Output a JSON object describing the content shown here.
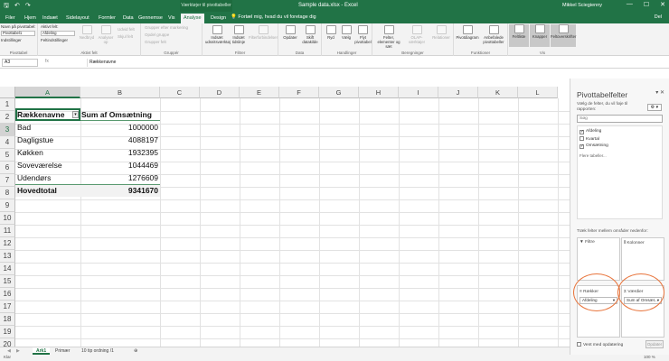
{
  "app": {
    "title": "Sample data.xlsx - Excel",
    "context_tab": "Værktøjer til pivottabeller",
    "user": "Mikkel Sciegienny"
  },
  "tabs": [
    "Filer",
    "Hjem",
    "Indsæt",
    "Sidelayout",
    "Formler",
    "Data",
    "Gennemse",
    "Vis",
    "Analyse",
    "Design"
  ],
  "active_tab": "Analyse",
  "tellme": "Fortæl mig, hvad du vil foretage dig",
  "share": "Del",
  "ribbon": {
    "pivot_name_label": "Navn på pivottabel:",
    "pivot_name_value": "Pivottabel1",
    "options_label": "Indstillinger",
    "active_field_label": "Aktivt felt:",
    "active_field_value": "Afdeling",
    "field_settings": "Feltindstillinger",
    "drilldown": "Nedbryd",
    "drillup": "Analyser op",
    "expand_field": "Udvid felt",
    "collapse_field": "Skjul felt",
    "group_selection": "Grupper efter markering",
    "ungroup": "Opdel gruppe",
    "group_field": "Grupper felt",
    "insert_slicer": "Indsæt udsnitsværktøj",
    "insert_timeline": "Indsæt tidslinje",
    "filter_connections": "Filterforbindelser",
    "refresh": "Opdater",
    "change_source": "Skift datakilde",
    "clear": "Ryd",
    "select": "Vælg",
    "move_pivot": "Flyt pivottabel",
    "fields_items_sets": "Felter, elementer og sæt",
    "olap_tools": "OLAP-værktøjer",
    "relations": "Relationer",
    "pivot_chart": "Pivotdiagram",
    "recommended": "Anbefalede pivottabeller",
    "field_list": "Feltliste",
    "buttons": "Knapper",
    "field_headers": "Feltoverskrifter",
    "groups": {
      "pivot": "Pivottabel",
      "active_field": "Aktivt felt",
      "group": "Gruppér",
      "filter": "Filtrer",
      "data": "Data",
      "actions": "Handlinger",
      "calculations": "Beregninger",
      "tools": "Funktioner",
      "show": "Vis"
    }
  },
  "formula_bar": {
    "name_box": "A3",
    "fx": "fx",
    "formula": "Rækkenavne"
  },
  "columns": [
    "A",
    "B",
    "C",
    "D",
    "E",
    "F",
    "G",
    "H",
    "I",
    "J",
    "K",
    "L"
  ],
  "rows": [
    "1",
    "2",
    "3",
    "4",
    "5",
    "6",
    "7",
    "8",
    "9",
    "10",
    "11",
    "12",
    "13",
    "14",
    "15",
    "16",
    "17",
    "18",
    "19",
    "20",
    "21"
  ],
  "pivot": {
    "header_label": "Rækkenavne",
    "header_value": "Sum af Omsætning",
    "items": [
      {
        "label": "Bad",
        "value": "1000000"
      },
      {
        "label": "Dagligstue",
        "value": "4088197"
      },
      {
        "label": "Køkken",
        "value": "1932395"
      },
      {
        "label": "Soveværelse",
        "value": "1044469"
      },
      {
        "label": "Udendørs",
        "value": "1276609"
      }
    ],
    "total_label": "Hovedtotal",
    "total_value": "9341670"
  },
  "sheets": [
    "Ark1",
    "Primær",
    "10 tip ordning /1"
  ],
  "active_sheet": "Ark1",
  "status": {
    "ready": "Klar",
    "zoom": "100 %"
  },
  "pane": {
    "title": "Pivottabelfelter",
    "hint": "Vælg de felter, du vil føje til rapporten:",
    "search_placeholder": "Søg",
    "fields": [
      {
        "label": "Afdeling",
        "checked": true
      },
      {
        "label": "Kvartal",
        "checked": false
      },
      {
        "label": "Omsætning",
        "checked": true
      }
    ],
    "more_tables": "Flere tabeller...",
    "drag_hint": "Træk felter mellem områder nedenfor:",
    "areas": {
      "filters": "Filtre",
      "columns": "Kolonner",
      "rows": "Rækker",
      "values": "Værdier"
    },
    "rows_pill": "Afdeling",
    "values_pill": "Sum af Omsæt...",
    "defer": "Vent med opdatering",
    "update": "Opdater"
  },
  "colors": {
    "brand": "#217346",
    "highlight_circle": "#e8743b"
  }
}
